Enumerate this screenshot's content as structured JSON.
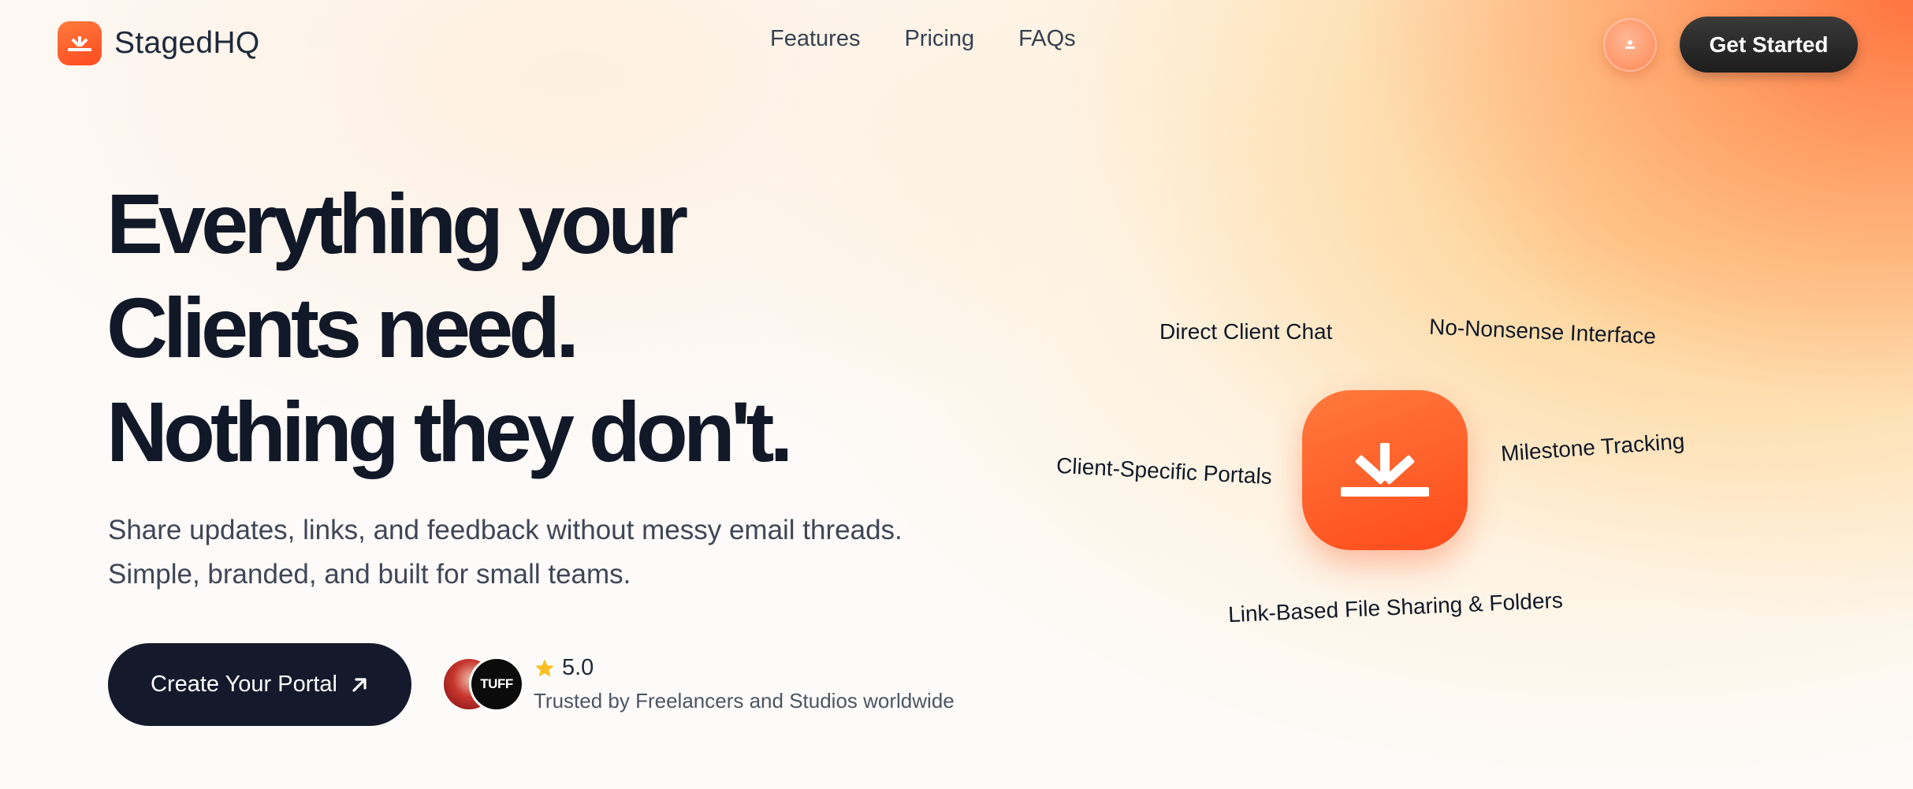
{
  "brand": {
    "name": "StagedHQ",
    "accent_color": "#ff5722",
    "logo_icon": "sunrise-burst-icon"
  },
  "nav": {
    "items": [
      {
        "label": "Features"
      },
      {
        "label": "Pricing"
      },
      {
        "label": "FAQs"
      }
    ],
    "cta_label": "Get Started",
    "avatar_icon": "user-avatar-icon"
  },
  "hero": {
    "headline": [
      "Everything your",
      "Clients need.",
      "Nothing they don't."
    ],
    "subtext": [
      "Share updates, links, and feedback without messy email threads.",
      "Simple, branded, and built for small teams."
    ],
    "cta_label": "Create Your Portal",
    "cta_icon": "arrow-up-right-icon",
    "rating": "5.0",
    "rating_icon": "star-icon",
    "trust_text": "Trusted by Freelancers and Studios worldwide",
    "trust_badge_text": "TUFF"
  },
  "features": [
    {
      "label": "Direct Client Chat"
    },
    {
      "label": "No-Nonsense Interface"
    },
    {
      "label": "Client-Specific Portals"
    },
    {
      "label": "Milestone Tracking"
    },
    {
      "label": "Link-Based File Sharing & Folders"
    }
  ]
}
